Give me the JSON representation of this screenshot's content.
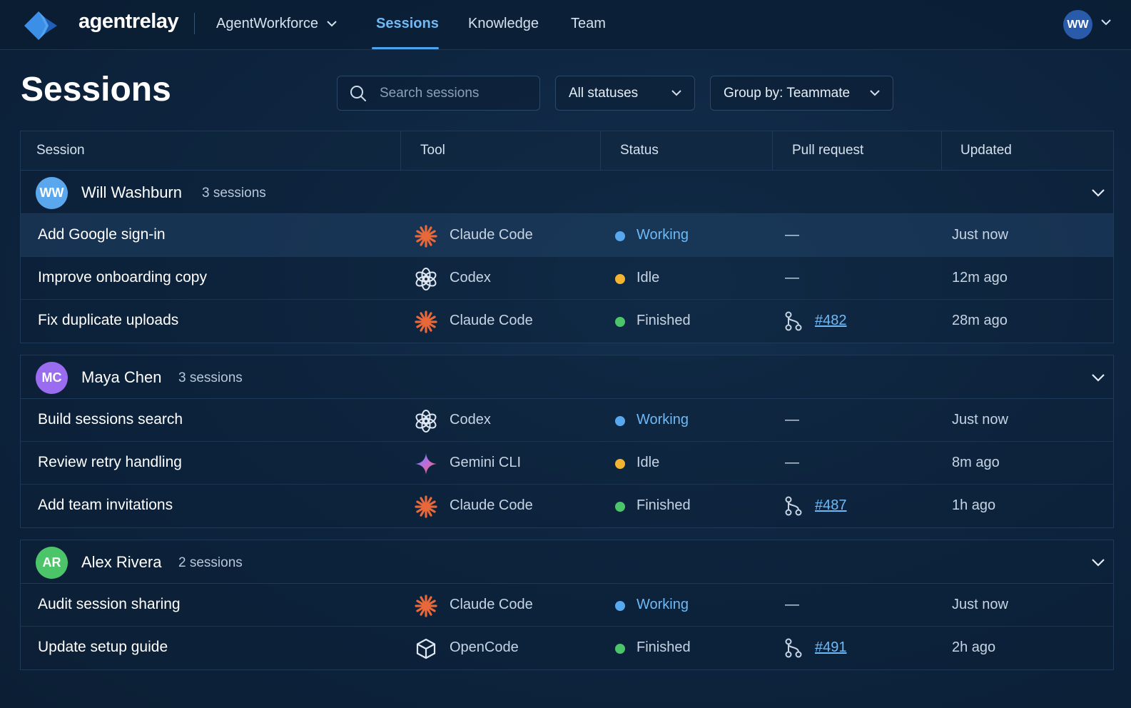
{
  "nav": {
    "brand": "agentrelay",
    "workspace": "AgentWorkforce",
    "links": [
      "Sessions",
      "Knowledge",
      "Team"
    ],
    "active_link": "Sessions",
    "user_initials": "WW"
  },
  "page": {
    "title": "Sessions",
    "search_placeholder": "Search sessions",
    "status_filter": "All statuses",
    "group_by": "Group by: Teammate"
  },
  "table": {
    "headers": [
      "Session",
      "Tool",
      "Status",
      "Pull request",
      "Updated"
    ]
  },
  "colors": {
    "accent": "#4ea4ec",
    "working": "#58a8f0",
    "idle": "#f3b431",
    "finished": "#4cc56a"
  },
  "groups": [
    {
      "initials": "WW",
      "name": "Will Washburn",
      "count": "3 sessions",
      "avatar_color": "#5aa7ee",
      "rows": [
        {
          "title": "Add Google sign-in",
          "tool": "Claude Code",
          "tool_icon": "claude-icon",
          "status": "Working",
          "pr": "—",
          "updated": "Just now",
          "highlight": true
        },
        {
          "title": "Improve onboarding copy",
          "tool": "Codex",
          "tool_icon": "openai-icon",
          "status": "Idle",
          "pr": "—",
          "updated": "12m ago"
        },
        {
          "title": "Fix duplicate uploads",
          "tool": "Claude Code",
          "tool_icon": "claude-icon",
          "status": "Finished",
          "pr": "#482",
          "updated": "28m ago"
        }
      ]
    },
    {
      "initials": "MC",
      "name": "Maya Chen",
      "count": "3 sessions",
      "avatar_color": "#9a6cf0",
      "rows": [
        {
          "title": "Build sessions search",
          "tool": "Codex",
          "tool_icon": "openai-icon",
          "status": "Working",
          "pr": "—",
          "updated": "Just now"
        },
        {
          "title": "Review retry handling",
          "tool": "Gemini CLI",
          "tool_icon": "gemini-icon",
          "status": "Idle",
          "pr": "—",
          "updated": "8m ago"
        },
        {
          "title": "Add team invitations",
          "tool": "Claude Code",
          "tool_icon": "claude-icon",
          "status": "Finished",
          "pr": "#487",
          "updated": "1h ago"
        }
      ]
    },
    {
      "initials": "AR",
      "name": "Alex Rivera",
      "count": "2 sessions",
      "avatar_color": "#4cc56a",
      "rows": [
        {
          "title": "Audit session sharing",
          "tool": "Claude Code",
          "tool_icon": "claude-icon",
          "status": "Working",
          "pr": "—",
          "updated": "Just now"
        },
        {
          "title": "Update setup guide",
          "tool": "OpenCode",
          "tool_icon": "opencode-icon",
          "status": "Finished",
          "pr": "#491",
          "updated": "2h ago"
        }
      ]
    }
  ]
}
